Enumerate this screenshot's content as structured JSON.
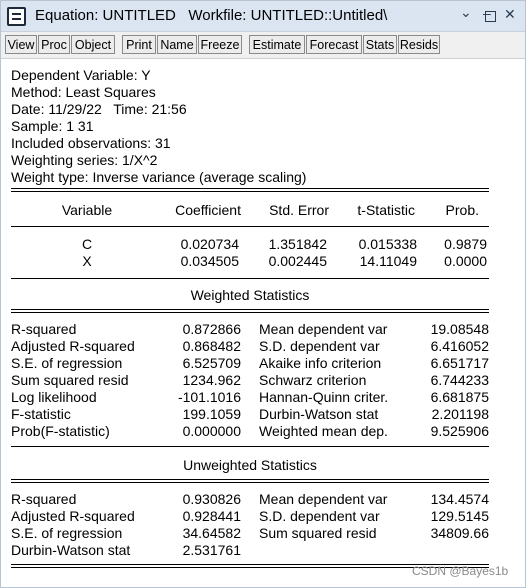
{
  "window": {
    "title": "Equation: UNTITLED   Workfile: UNTITLED::Untitled\\"
  },
  "toolbar": {
    "buttons": [
      "View",
      "Proc",
      "Object",
      "Print",
      "Name",
      "Freeze",
      "Estimate",
      "Forecast",
      "Stats",
      "Resids"
    ]
  },
  "header": {
    "dependent": "Dependent Variable: Y",
    "method": "Method: Least Squares",
    "date": "Date: 11/29/22   Time: 21:56",
    "sample": "Sample: 1 31",
    "included": "Included observations: 31",
    "weighting": "Weighting series: 1/X^2",
    "weight_type": "Weight type: Inverse variance (average scaling)"
  },
  "coef_table": {
    "columns": [
      "Variable",
      "Coefficient",
      "Std. Error",
      "t-Statistic",
      "Prob."
    ],
    "rows": [
      [
        "C",
        "0.020734",
        "1.351842",
        "0.015338",
        "0.9879"
      ],
      [
        "X",
        "0.034505",
        "0.002445",
        "14.11049",
        "0.0000"
      ]
    ]
  },
  "weighted": {
    "title": "Weighted Statistics",
    "rows": [
      [
        "R-squared",
        "0.872866",
        "Mean dependent var",
        "19.08548"
      ],
      [
        "Adjusted R-squared",
        "0.868482",
        "S.D. dependent var",
        "6.416052"
      ],
      [
        "S.E. of regression",
        "6.525709",
        "Akaike info criterion",
        "6.651717"
      ],
      [
        "Sum squared resid",
        "1234.962",
        "Schwarz criterion",
        "6.744233"
      ],
      [
        "Log likelihood",
        "-101.1016",
        "Hannan-Quinn criter.",
        "6.681875"
      ],
      [
        "F-statistic",
        "199.1059",
        "Durbin-Watson stat",
        "2.201198"
      ],
      [
        "Prob(F-statistic)",
        "0.000000",
        "Weighted mean dep.",
        "9.525906"
      ]
    ]
  },
  "unweighted": {
    "title": "Unweighted Statistics",
    "rows": [
      [
        "R-squared",
        "0.930826",
        "Mean dependent var",
        "134.4574"
      ],
      [
        "Adjusted R-squared",
        "0.928441",
        "S.D. dependent var",
        "129.5145"
      ],
      [
        "S.E. of regression",
        "34.64582",
        "Sum squared resid",
        "34809.66"
      ],
      [
        "Durbin-Watson stat",
        "2.531761",
        "",
        ""
      ]
    ]
  },
  "watermark": "CSDN @Bayes1b"
}
